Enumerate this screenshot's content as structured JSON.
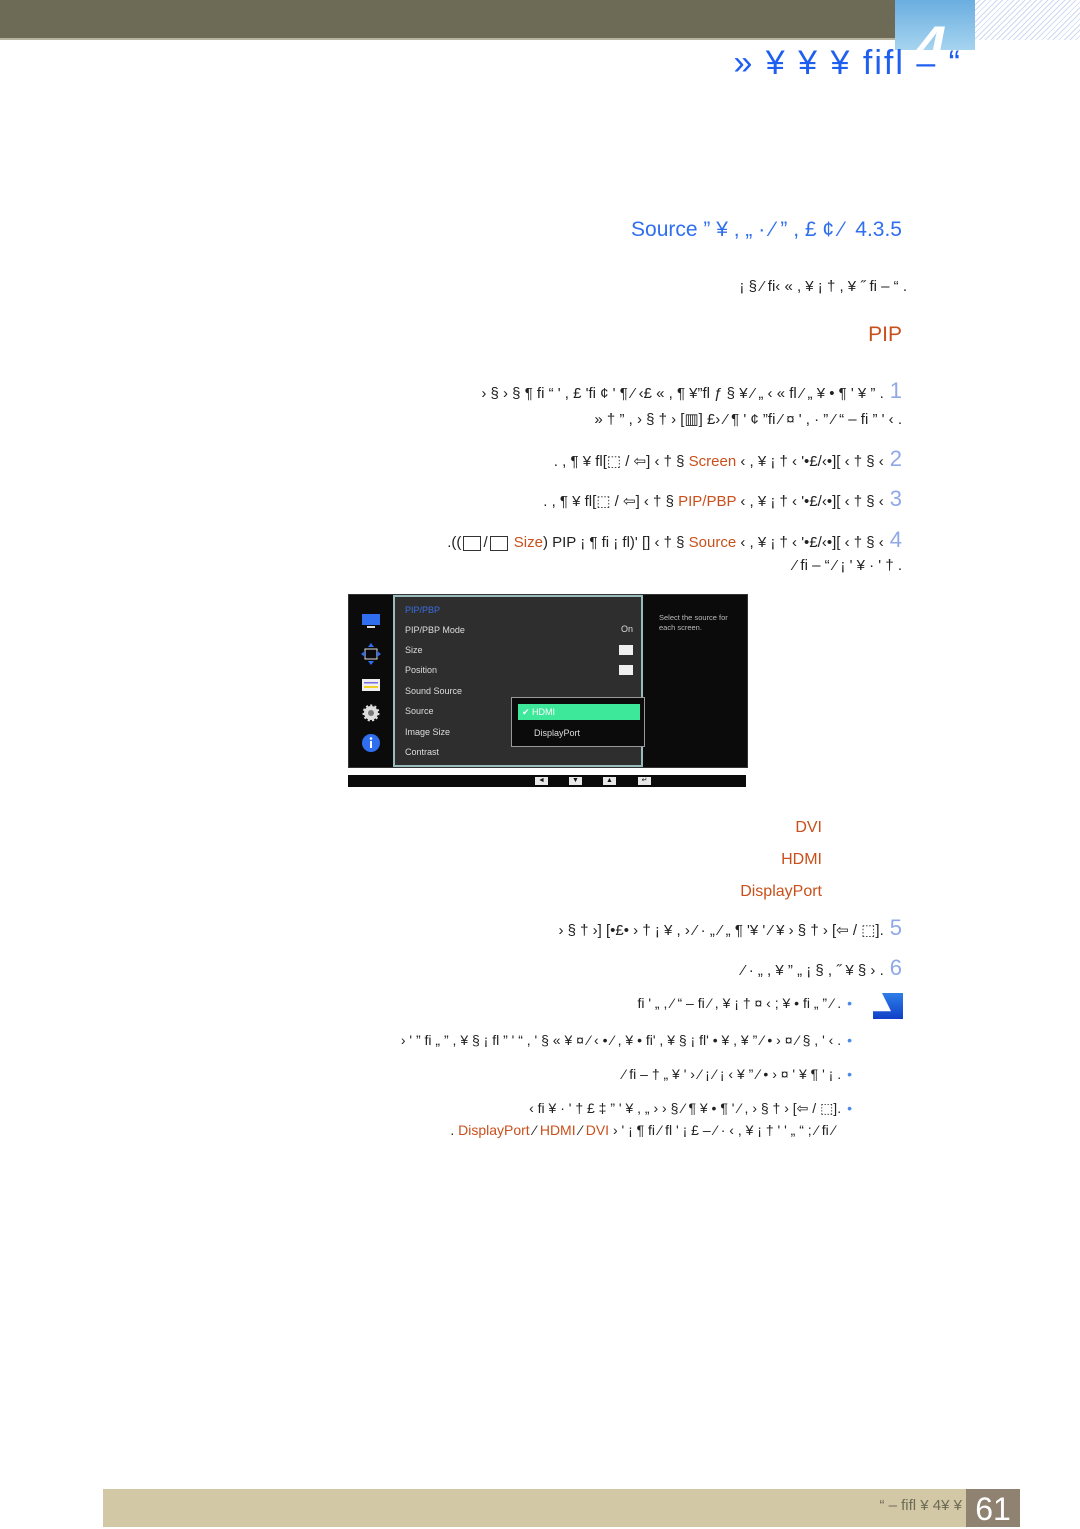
{
  "header": {
    "chapter_number": "4",
    "chapter_title": "“ – fifl ¥  ¥ ¥ «"
  },
  "section": {
    "number": "4.3.5",
    "title": "Source ” ¥ , „ ·  ⁄ ” , £ ¢ ⁄",
    "intro": ". “ – fi‹ «  , ¥ ¡ †  , ¥ ˝ fi ⁄ § ¡"
  },
  "pip_heading": "PIP",
  "steps": [
    {
      "num": "1",
      "text": ". ” ¥ ' ¶ •  ¥ „ ⁄ fi  “ ' , £ 'fi  ¢ ' ¶ ⁄ ‹£ «  , ¶ ¥”fl ƒ § ¥ ⁄ „ ‹ «  fl ¶ § ‹ § ‹",
      "cont": ". › '  ” fi ⁄ ¤ ' , · ” ⁄ “ – fi”  ¢ ' ¶ ⁄ ‹£ [▥]  ‹ †   § ‹ , ” † «"
    },
    {
      "num": "2",
      "pre": ". , ¶ ¥ fl[",
      "key": "⬚ / ⇦",
      "post": "]  ‹ †   § ",
      "hl": "Screen",
      "tail": " ‹   , ¥ ¡ † ‹  '•£/‹•][  ‹ †   § ‹"
    },
    {
      "num": "3",
      "pre": ". , ¶ ¥ fl[",
      "key": "⬚ / ⇦",
      "post": "]  ‹ †   § ",
      "hl": "PIP/PBP",
      "tail": " ‹   , ¥ ¡ † ‹  '•£/‹•][  ‹ †   § ‹"
    },
    {
      "num": "4",
      "pre": ".((",
      "size_hl": "Size",
      "mid": ") PIP  ¡ ¶ fi ¡  fl)' [",
      "post": "]  ‹ †   § ",
      "hl": "Source",
      "tail": " ‹   , ¥ ¡ † ‹  '•£/‹•][  ‹ †   § ‹",
      "cont": ". † ' · ¥ '   ¡ ⁄  “ – fi ⁄"
    }
  ],
  "osd": {
    "menu_title": "PIP/PBP",
    "items": [
      "PIP/PBP Mode",
      "Size",
      "Position",
      "Sound Source",
      "Source",
      "Image Size",
      "Contrast"
    ],
    "mode_value": "On",
    "dropdown_options": [
      "HDMI",
      "DisplayPort"
    ],
    "dropdown_selected": "HDMI",
    "help_text": "Select the source for each screen.",
    "nav_buttons": [
      "◄",
      "▼",
      "▲",
      "↵"
    ],
    "side_icons": [
      "picture-icon",
      "position-arrows-icon",
      "onscreen-display-icon",
      "settings-gear-icon",
      "info-icon"
    ]
  },
  "source_options": [
    "DVI",
    "HDMI",
    "DisplayPort"
  ],
  "steps_after": [
    {
      "num": "5",
      "text": ".[⬚ / ⇦]  ‹ †   § ‹ ¥  ⁄ ' ¥' ¶ „ ⁄ „ ·  ⁄ ‹    , ¥ ¡ † ‹ •£•] [‹ †   § ‹"
    },
    {
      "num": "6",
      "text": ". ‹ § ¥ ˝ , § ¡   „ ” ¥ , „ ·  ⁄"
    }
  ],
  "notes": [
    ". ⁄  ” „ fi ' „   , ⁄  “ – fi ⁄ , ¥ ¡ †   ¤ ‹ ; ¥ • fi",
    ". › ' , §  ⁄ ¤ ‹ • ⁄ ” ¥ , ¥ • 'fi „ ”   , ¥ § ¡ fl ” ' “  , ' § « ¥ ¤ ⁄ ‹ • ⁄ , ¥ • fi'   , ¥ § ¡ fl ” '  ‹",
    ". ¡ ' ¶ ¥   ' ¤ ‹ • ⁄ ” ¥  ›    ¡ ⁄ ¡ ⁄ ‹  ' ¥ „ † – fi ⁄",
    ".[⬚ / ⇦]  ‹ †    § ‹ , ⁄ ' ¶ •   ¥ ¶ ⁄ § ‹ ‹ „  , ¥   ' ” ‡ £ † ' · ¥ fi  ›"
  ],
  "note_last_line": {
    "prefix": ". ",
    "hl1": "DisplayPort",
    "sep": " ⁄ ",
    "hl2": "HDMI",
    "hl3": "DVI",
    "suffix": " › ' ¡ ¶ fi ⁄ fl ' ¡ £ – ⁄ · ‹  , ¥ ¡ † ' ' „  “ ; ⁄ fi ⁄"
  },
  "footer": {
    "label": "“ – fifl ¥  4¥ ¥",
    "page_number": "61"
  },
  "colors": {
    "accent_blue": "#2f6fef",
    "highlight_orange": "#c9501c",
    "top_bar": "#6d6a55",
    "footer_bar": "#d3c8a6",
    "dropdown_selected": "#3ee89a"
  }
}
